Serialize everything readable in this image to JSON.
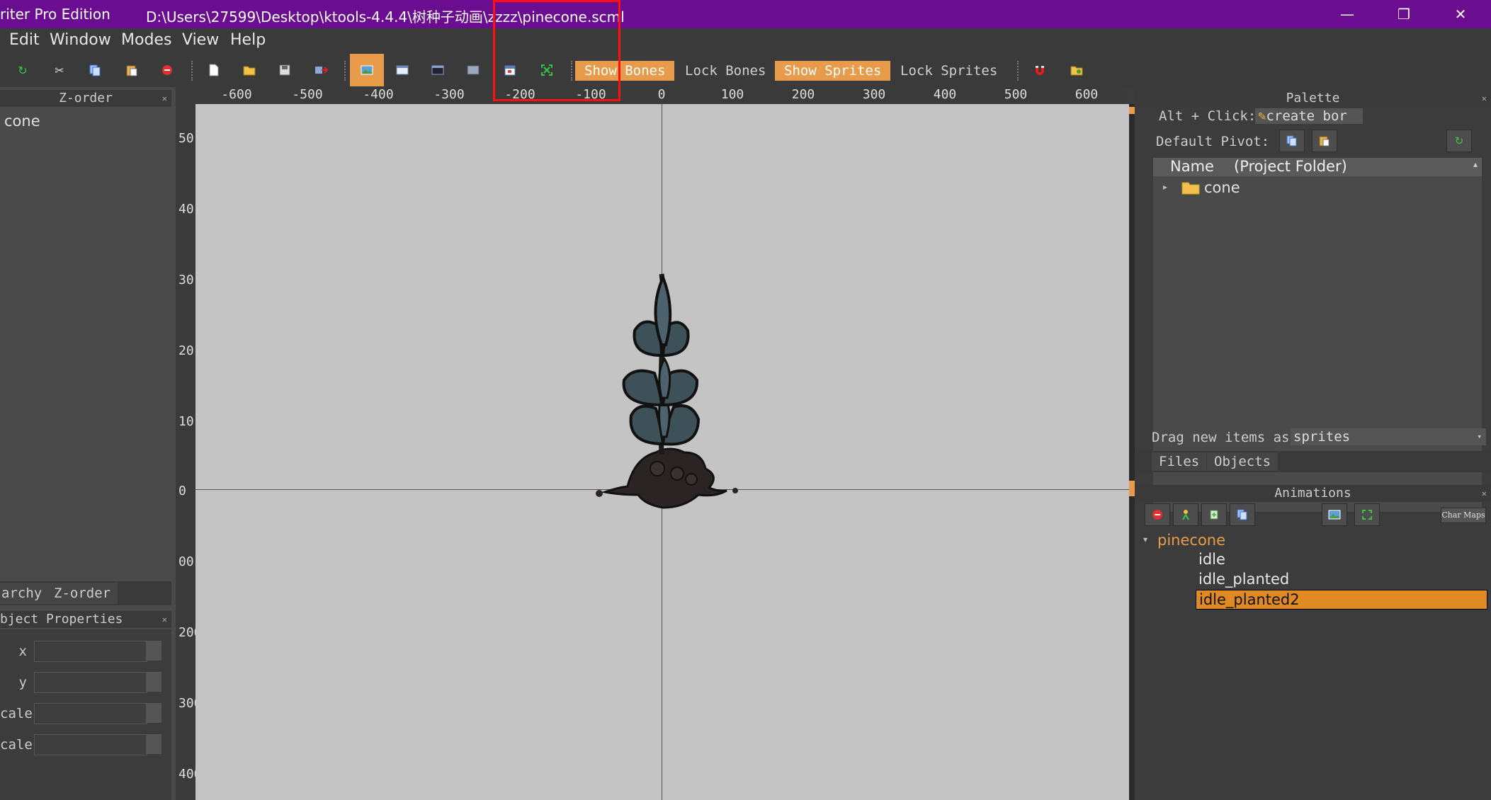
{
  "window": {
    "app_title": "riter Pro Edition",
    "file_path": "D:\\Users\\27599\\Desktop\\ktools-4.4.4\\树种子动画\\zzzz\\pinecone.scml",
    "min_glyph": "—",
    "max_glyph": "❐",
    "close_glyph": "✕"
  },
  "menu": [
    "Edit",
    "Window",
    "Modes",
    "View",
    "Help"
  ],
  "toolbar": {
    "show_bones": "Show Bones",
    "lock_bones": "Lock Bones",
    "show_sprites": "Show Sprites",
    "lock_sprites": "Lock Sprites"
  },
  "ruler": {
    "x_labels": [
      "-600",
      "-500",
      "-400",
      "-300",
      "-200",
      "-100",
      "0",
      "100",
      "200",
      "300",
      "400",
      "500",
      "600"
    ],
    "y_labels": [
      "50",
      "40",
      "30",
      "20",
      "10",
      "0",
      "00",
      "200",
      "300",
      "400"
    ]
  },
  "left_dock": {
    "zorder_title": "Z-order",
    "zorder_items": [
      "cone"
    ],
    "tab_hierarchy": "archy",
    "tab_zorder": "Z-order",
    "object_props_title": "bject Properties",
    "props": [
      "x",
      "y",
      "cale",
      "cale"
    ]
  },
  "palette": {
    "title": "Palette",
    "alt_click_label": "Alt + Click:",
    "alt_click_value": "create bor",
    "default_pivot_label": "Default Pivot:",
    "col_name": "Name",
    "col_folder": "(Project Folder)",
    "tree_items": [
      "cone"
    ],
    "drag_label": "Drag new items as",
    "drag_value": "sprites",
    "tab_files": "Files",
    "tab_objects": "Objects"
  },
  "animations": {
    "title": "Animations",
    "char_maps": "Char Maps",
    "entity": "pinecone",
    "items": [
      "idle",
      "idle_planted",
      "idle_planted2"
    ],
    "selected": "idle_planted2"
  },
  "colors": {
    "titlebar": "#6a0d91",
    "accent": "#e89b4a",
    "selection": "#e08a24",
    "canvas": "#c4c4c4"
  }
}
